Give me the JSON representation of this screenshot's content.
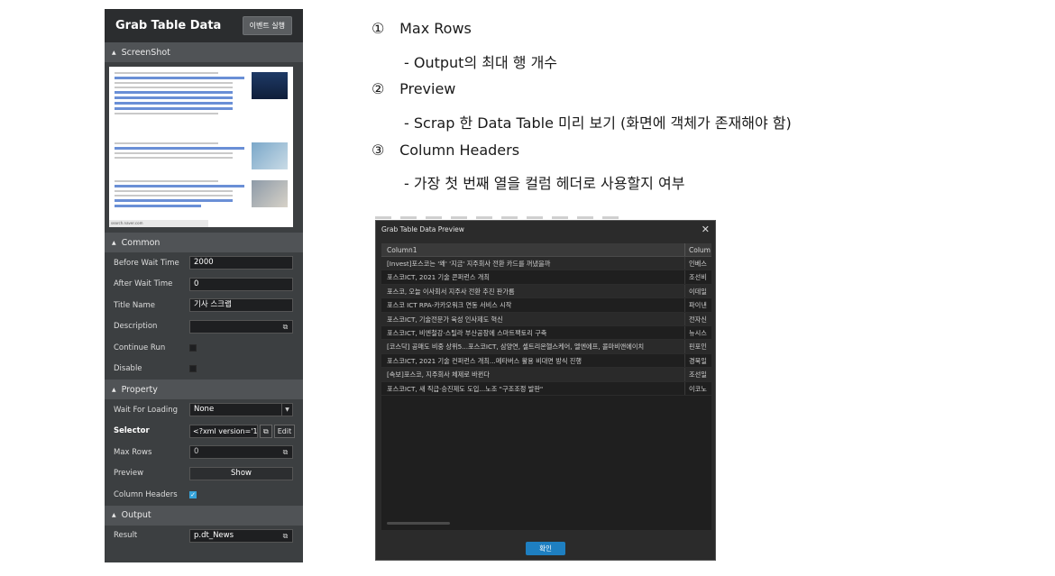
{
  "panel": {
    "title": "Grab Table Data",
    "run_button": "이벤트 실행",
    "sections": {
      "screenshot": "ScreenShot",
      "common": "Common",
      "property": "Property",
      "output": "Output"
    },
    "common": {
      "before_wait_label": "Before Wait Time",
      "before_wait_value": "2000",
      "after_wait_label": "After Wait Time",
      "after_wait_value": "0",
      "title_label": "Title Name",
      "title_value": "기사 스크랩",
      "description_label": "Description",
      "description_value": "",
      "continue_label": "Continue Run",
      "disable_label": "Disable"
    },
    "property": {
      "wait_label": "Wait For Loading",
      "wait_value": "None",
      "selector_label": "Selector",
      "selector_value": "<?xml version='1",
      "edit_label": "Edit",
      "max_rows_label": "Max Rows",
      "max_rows_value": "0",
      "preview_label": "Preview",
      "show_label": "Show",
      "column_headers_label": "Column Headers",
      "column_headers_checked": true
    },
    "output": {
      "result_label": "Result",
      "result_value": "p.dt_News"
    }
  },
  "descriptions": [
    {
      "num": "①",
      "title": "Max Rows",
      "detail": "- Output의 최대 행 개수"
    },
    {
      "num": "②",
      "title": "Preview",
      "detail": "- Scrap 한 Data Table 미리 보기 (화면에 객체가 존재해야 함)"
    },
    {
      "num": "③",
      "title": "Column Headers",
      "detail": "- 가장 첫 번째 열을 컬럼 헤더로 사용할지 여부"
    }
  ],
  "dialog": {
    "title": "Grab Table Data Preview",
    "close": "✕",
    "columns": [
      "Column1",
      "Colum"
    ],
    "rows": [
      [
        "[Invest]포스코는 '왜' '지금' 지주회사 전환 카드를 꺼냈을까",
        "인베스"
      ],
      [
        "포스코ICT, 2021 기술 콘퍼런스 개최",
        "조선비"
      ],
      [
        "포스코, 오늘 이사회서 지주사 전환 추진 판가름",
        "이데일"
      ],
      [
        "포스코 ICT RPA-카카오워크 연동 서비스 시작",
        "파이낸"
      ],
      [
        "포스코ICT, 기술전문가 육성 인사제도 혁신",
        "전자신"
      ],
      [
        "포스코ICT, 비엔철강·스틸라 부산공장에 스마트팩토리 구축",
        "뉴시스"
      ],
      [
        "[코스닥] 공매도 비중 상위5...포스코ICT, 삼양연, 셀트리온헬스케어, 엘엔에프, 콜마비앤에이치",
        "핀포인"
      ],
      [
        "포스코ICT, 2021 기술 컨퍼런스 개최...메타버스 활용 비대면 방식 진행",
        "경북일"
      ],
      [
        "[속보]포스코, 지주회사 체제로 바뀐다",
        "조선일"
      ],
      [
        "포스코ICT, 새 직급·승진제도 도입...노조 \"구조조정 발판\"",
        "이코노"
      ]
    ],
    "ok_label": "확인"
  },
  "colors": {
    "panel_bg": "#3c3f41",
    "accent": "#1e7fc1",
    "checkbox": "#36a3d9"
  }
}
